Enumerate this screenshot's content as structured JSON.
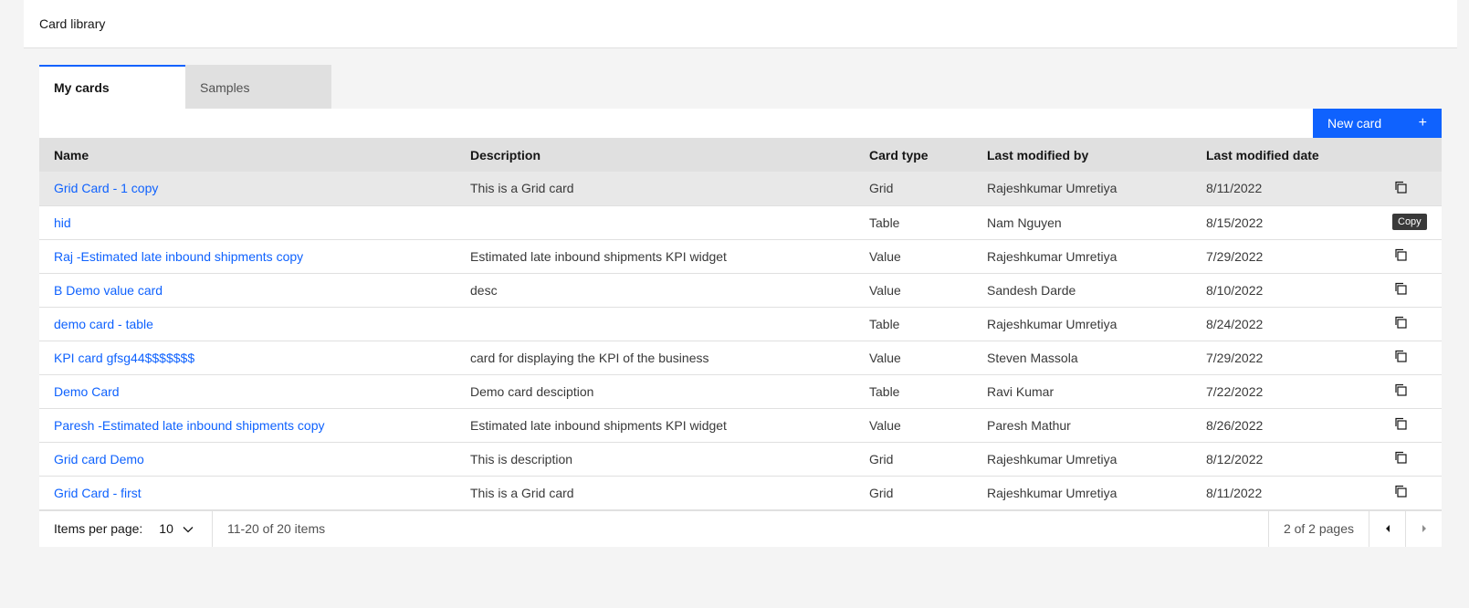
{
  "header": {
    "title": "Card library"
  },
  "tabs": [
    {
      "label": "My cards"
    },
    {
      "label": "Samples"
    }
  ],
  "toolbar": {
    "new_card_label": "New card",
    "plus": "+"
  },
  "table": {
    "columns": [
      "Name",
      "Description",
      "Card type",
      "Last modified by",
      "Last modified date"
    ],
    "rows": [
      {
        "name": "Grid Card - 1 copy",
        "description": "This is a Grid card",
        "type": "Grid",
        "by": "Rajeshkumar Umretiya",
        "date": "8/11/2022"
      },
      {
        "name": "hid",
        "description": "",
        "type": "Table",
        "by": "Nam Nguyen",
        "date": "8/15/2022"
      },
      {
        "name": "Raj -Estimated late inbound shipments copy",
        "description": "Estimated late inbound shipments KPI widget",
        "type": "Value",
        "by": "Rajeshkumar Umretiya",
        "date": "7/29/2022"
      },
      {
        "name": "B Demo value card",
        "description": "desc",
        "type": "Value",
        "by": "Sandesh Darde",
        "date": "8/10/2022"
      },
      {
        "name": "demo card - table",
        "description": "",
        "type": "Table",
        "by": "Rajeshkumar Umretiya",
        "date": "8/24/2022"
      },
      {
        "name": "KPI card gfsg44$$$$$$$",
        "description": "card for displaying the KPI of the business",
        "type": "Value",
        "by": "Steven Massola",
        "date": "7/29/2022"
      },
      {
        "name": "Demo Card",
        "description": "Demo card desciption",
        "type": "Table",
        "by": "Ravi Kumar",
        "date": "7/22/2022"
      },
      {
        "name": "Paresh -Estimated late inbound shipments copy",
        "description": "Estimated late inbound shipments KPI widget",
        "type": "Value",
        "by": "Paresh Mathur",
        "date": "8/26/2022"
      },
      {
        "name": "Grid card Demo",
        "description": "This is description",
        "type": "Grid",
        "by": "Rajeshkumar Umretiya",
        "date": "8/12/2022"
      },
      {
        "name": "Grid Card - first",
        "description": "This is a Grid card",
        "type": "Grid",
        "by": "Rajeshkumar Umretiya",
        "date": "8/11/2022"
      }
    ],
    "copy_tooltip": "Copy"
  },
  "pagination": {
    "items_per_page_label": "Items per page:",
    "items_per_page_value": "10",
    "range_text": "11-20 of 20 items",
    "pages_text": "2 of 2 pages"
  },
  "icons": {
    "copy": "copy-icon",
    "chevron": "chevron-down-icon",
    "prev": "caret-left-icon",
    "next": "caret-right-icon"
  },
  "colors": {
    "accent": "#0f62fe",
    "link": "#0f62fe"
  }
}
